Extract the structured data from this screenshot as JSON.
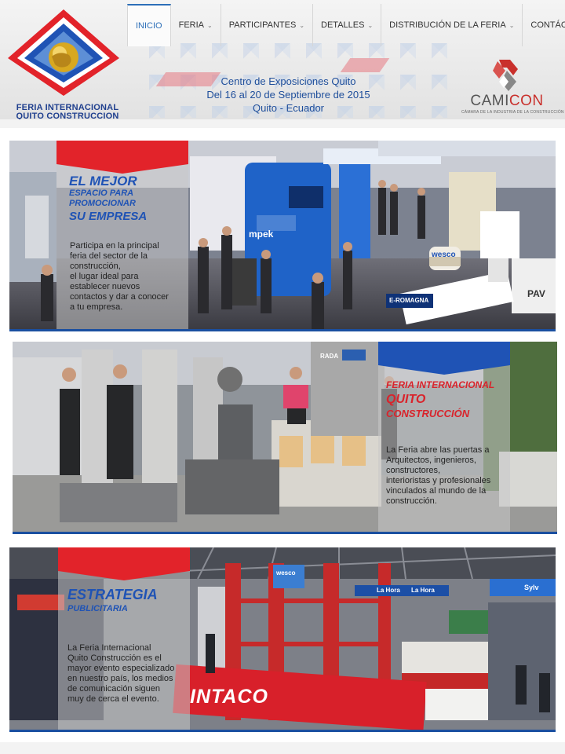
{
  "nav": {
    "items": [
      {
        "label": "INICIO",
        "has_dropdown": false,
        "active": true
      },
      {
        "label": "FERIA",
        "has_dropdown": true,
        "active": false
      },
      {
        "label": "PARTICIPANTES",
        "has_dropdown": true,
        "active": false
      },
      {
        "label": "DETALLES",
        "has_dropdown": true,
        "active": false
      },
      {
        "label": "DISTRIBUCIÓN DE LA FERIA",
        "has_dropdown": true,
        "active": false
      },
      {
        "label": "CONTÁCTENOS",
        "has_dropdown": true,
        "active": false
      }
    ],
    "chevron_icon": "chevron-down-icon"
  },
  "logo": {
    "line1": "FERIA INTERNACIONAL",
    "line2": "QUITO CONSTRUCCION"
  },
  "event": {
    "venue": "Centro de Exposiciones Quito",
    "dates": "Del 16 al 20 de Septiembre de 2015",
    "location": "Quito - Ecuador"
  },
  "sponsor": {
    "name_part1": "CAMI",
    "name_part2": "CON",
    "subtitle": "CÁMARA DE LA INDUSTRIA DE LA CONSTRUCCIÓN"
  },
  "banners": [
    {
      "heading": "EL MEJOR",
      "sub1": "ESPACIO PARA",
      "sub2": "PROMOCIONAR",
      "sub3": "SU EMPRESA",
      "description": [
        "Participa en la principal",
        "feria del sector de la",
        "construcción,",
        "el lugar ideal para",
        "establecer nuevos",
        "contactos y dar a conocer",
        "a tu empresa."
      ],
      "signs": [
        "mpek",
        "wesco",
        "E-ROMAGNA",
        "PAV"
      ]
    },
    {
      "heading1": "FERIA INTERNACIONAL",
      "heading2": "QUITO",
      "heading3": "CONSTRUCCIÓN",
      "description": [
        "La Feria abre las puertas a",
        "Arquitectos, ingenieros,",
        "constructores,",
        "interioristas y profesionales",
        "vinculados al mundo de la",
        "construcción."
      ],
      "signs": [
        "RADA"
      ]
    },
    {
      "heading": "ESTRATEGIA",
      "sub": "PUBLICITARIA",
      "description": [
        "La Feria Internacional",
        "Quito Construcción es el",
        "mayor evento especializado",
        "en nuestro país, los medios",
        "de comunicación siguen",
        "muy de cerca el evento."
      ],
      "signs": [
        "INTACO",
        "La Hora",
        "La Hora",
        "wesco",
        "Sylv"
      ]
    }
  ],
  "colors": {
    "brand_blue": "#1f53b5",
    "brand_red": "#e2232a",
    "nav_active": "#2d6fb8"
  }
}
